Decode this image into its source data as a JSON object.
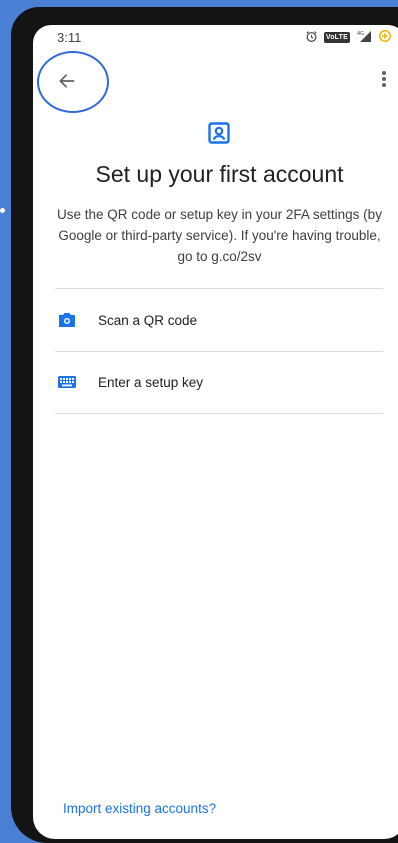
{
  "status_bar": {
    "time": "3:11",
    "volte": "VoLTE"
  },
  "header": {
    "title": "Set up your first account",
    "subtitle": "Use the QR code or setup key in your 2FA settings (by Google or third-party service). If you're having trouble, go to g.co/2sv"
  },
  "options": [
    {
      "label": "Scan a QR code",
      "icon": "camera-icon"
    },
    {
      "label": "Enter a setup key",
      "icon": "keyboard-icon"
    }
  ],
  "footer": {
    "import_link": "Import existing accounts?"
  },
  "colors": {
    "accent": "#1a73e8",
    "background": "#4a7fd4",
    "highlight_circle": "#2f6ad6"
  }
}
